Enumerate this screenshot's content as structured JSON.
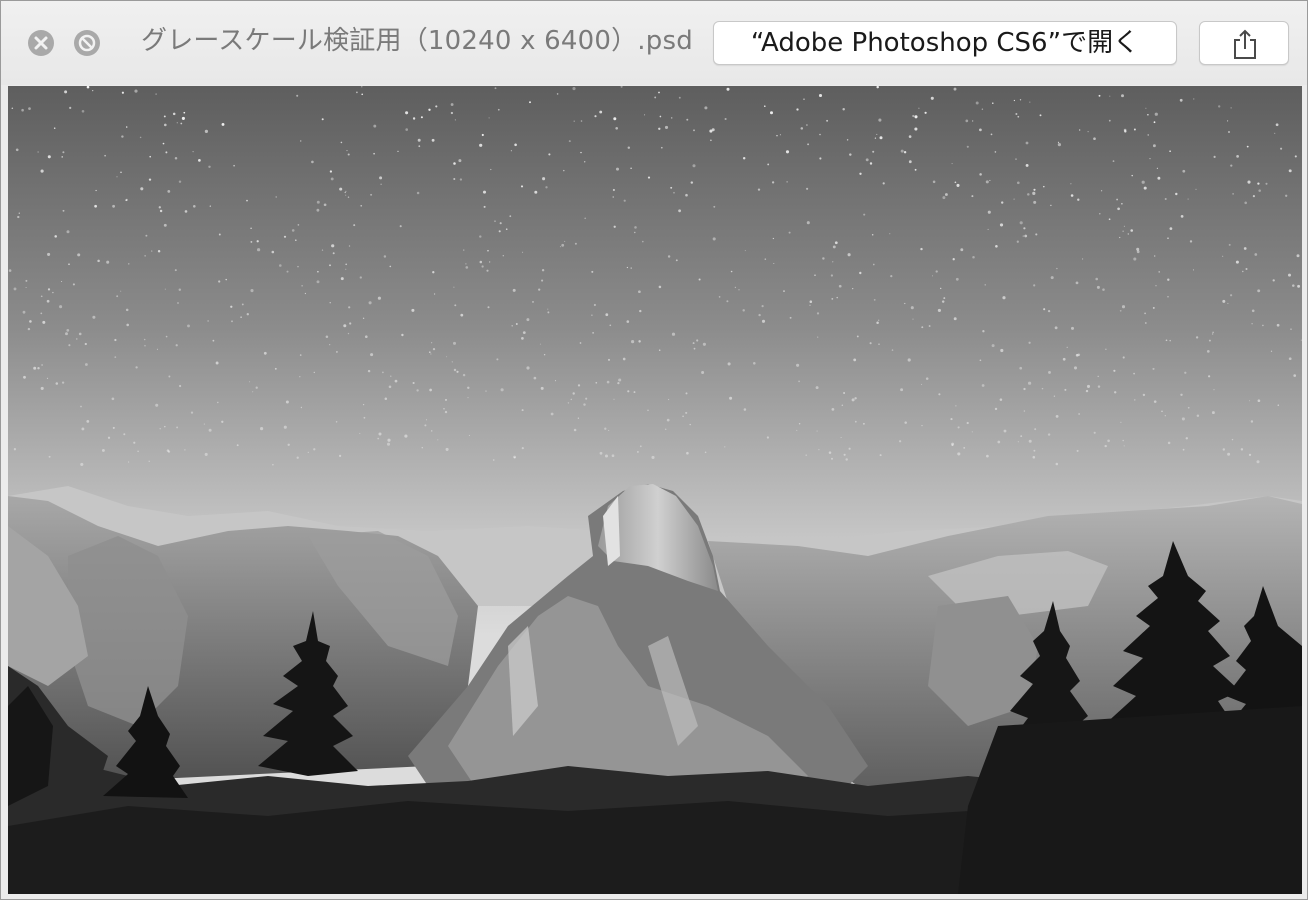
{
  "window": {
    "title": "グレースケール検証用（10240 x 6400）.psd",
    "open_with_label": "“Adobe Photoshop CS6”で開く"
  },
  "icons": {
    "close": "close-circle-icon",
    "fullscreen": "fullscreen-disabled-icon",
    "share": "share-icon"
  },
  "preview": {
    "description_colors": {
      "sky_top": "#5e5e5e",
      "sky_horizon": "#dcdcdc",
      "mountain_light": "#bdbdbd",
      "mountain_dark": "#4a4a4a",
      "forest": "#1c1c1c"
    }
  }
}
